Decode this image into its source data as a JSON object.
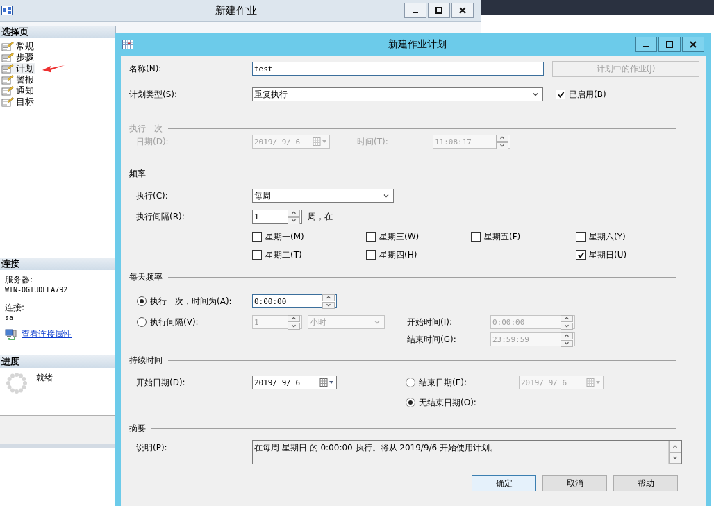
{
  "back_window": {
    "title": "新建作业",
    "select_page": {
      "header": "选择页",
      "items": [
        {
          "label": "常规",
          "selected": false
        },
        {
          "label": "步骤",
          "selected": false
        },
        {
          "label": "计划",
          "selected": true
        },
        {
          "label": "警报",
          "selected": false
        },
        {
          "label": "通知",
          "selected": false
        },
        {
          "label": "目标",
          "selected": false
        }
      ]
    },
    "connection": {
      "header": "连接",
      "server_label": "服务器:",
      "server": "WIN-OGIUDLEA792",
      "login_label": "连接:",
      "login": "sa",
      "link": "查看连接属性"
    },
    "progress": {
      "header": "进度",
      "status": "就绪"
    }
  },
  "dialog": {
    "title": "新建作业计划",
    "name": {
      "label": "名称(N):",
      "value": "test"
    },
    "jobs_button": {
      "label": "计划中的作业(J)",
      "disabled": true
    },
    "schedule_type": {
      "label": "计划类型(S):",
      "value": "重复执行"
    },
    "enabled": {
      "label": "已启用(B)",
      "checked": true
    },
    "one_time": {
      "title": "执行一次",
      "disabled": true,
      "date_label": "日期(D):",
      "date": "2019/ 9/ 6",
      "time_label": "时间(T):",
      "time": "11:08:17"
    },
    "frequency": {
      "title": "频率",
      "occurs_label": "执行(C):",
      "occurs": "每周",
      "recurs_label": "执行间隔(R):",
      "recurs": "1",
      "recurs_unit": "周，在",
      "days": [
        {
          "label": "星期一(M)",
          "checked": false
        },
        {
          "label": "星期三(W)",
          "checked": false
        },
        {
          "label": "星期五(F)",
          "checked": false
        },
        {
          "label": "星期六(Y)",
          "checked": false
        },
        {
          "label": "星期二(T)",
          "checked": false
        },
        {
          "label": "星期四(H)",
          "checked": false
        },
        {
          "label": "星期日(U)",
          "checked": true
        }
      ]
    },
    "daily": {
      "title": "每天频率",
      "options": [
        {
          "label": "执行一次，时间为(A):",
          "selected": true
        },
        {
          "label": "执行间隔(V):",
          "selected": false
        }
      ],
      "once_time": "0:00:00",
      "interval": "1",
      "interval_unit": "小时",
      "start_label": "开始时间(I):",
      "start": "0:00:00",
      "end_label": "结束时间(G):",
      "end": "23:59:59"
    },
    "duration": {
      "title": "持续时间",
      "start_label": "开始日期(D):",
      "start": "2019/ 9/ 6",
      "end_options": [
        {
          "label": "结束日期(E):",
          "selected": false
        },
        {
          "label": "无结束日期(O):",
          "selected": true
        }
      ],
      "end_date": "2019/ 9/ 6"
    },
    "summary": {
      "title": "摘要",
      "label": "说明(P):",
      "text": "在每周 星期日 的 0:00:00 执行。将从 2019/9/6 开始使用计划。"
    },
    "buttons": [
      {
        "label": "确定",
        "default": true
      },
      {
        "label": "取消",
        "default": false
      },
      {
        "label": "帮助",
        "default": false
      }
    ]
  }
}
